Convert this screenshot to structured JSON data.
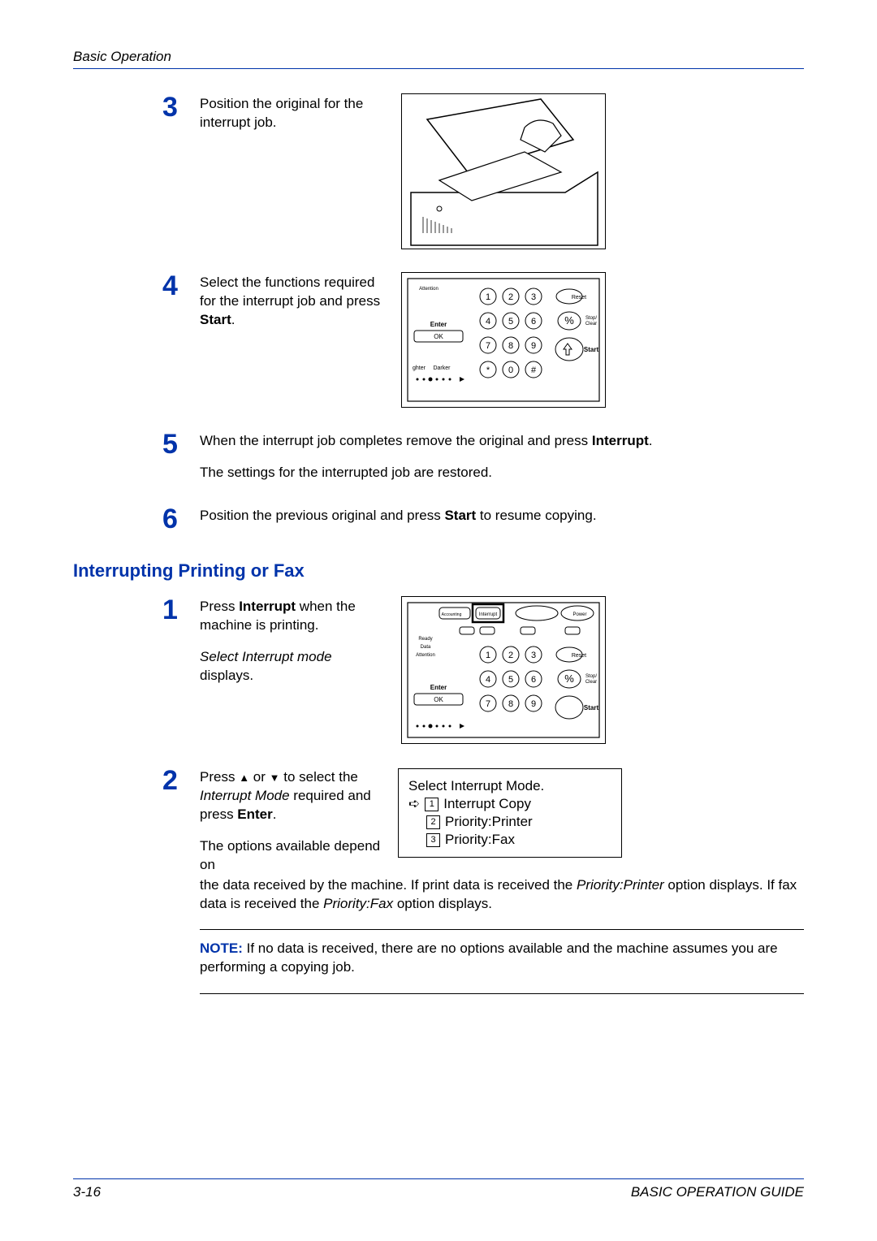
{
  "header": {
    "section": "Basic Operation"
  },
  "steps_a": {
    "s3": {
      "num": "3",
      "text": "Position the original for the interrupt job."
    },
    "s4": {
      "num": "4",
      "text_a": "Select the functions required for the interrupt job and press ",
      "bold": "Start",
      "text_b": "."
    },
    "s5": {
      "num": "5",
      "line1_a": "When the interrupt job completes remove the original and press ",
      "line1_bold": "Interrupt",
      "line1_b": ".",
      "line2": "The settings for the interrupted job are restored."
    },
    "s6": {
      "num": "6",
      "text_a": "Position the previous original and press ",
      "bold": "Start",
      "text_b": " to resume copying."
    }
  },
  "section_title": "Interrupting Printing or Fax",
  "steps_b": {
    "s1": {
      "num": "1",
      "line1_a": "Press ",
      "line1_bold": "Interrupt",
      "line1_b": " when the machine is printing.",
      "line2_i": "Select Interrupt mode",
      "line2_b": " displays."
    },
    "s2": {
      "num": "2",
      "line1_a": "Press ",
      "tri_up": "▲",
      "line1_mid": " or ",
      "tri_down": "▼",
      "line1_b": " to select the ",
      "line1_i": "Interrupt Mode",
      "line1_c": " required and press ",
      "line1_bold": "Enter",
      "line1_d": ".",
      "para_a": "The options available depend on the data received by the machine. If print data is received the ",
      "para_i1": "Priority:Printer",
      "para_b": " option displays. If fax data is received the ",
      "para_i2": "Priority:Fax",
      "para_c": " option displays."
    }
  },
  "lcd": {
    "title": "Select Interrupt Mode.",
    "opt1": "Interrupt Copy",
    "opt2": "Priority:Printer",
    "opt3": "Priority:Fax",
    "arrow": "➪",
    "n1": "1",
    "n2": "2",
    "n3": "3"
  },
  "note": {
    "label": "NOTE:",
    "text": " If no data is received, there are no options available and the machine assumes you are performing a copying job."
  },
  "keypad": {
    "nums": [
      "1",
      "2",
      "3",
      "4",
      "5",
      "6",
      "7",
      "8",
      "9",
      "*",
      "0",
      "#"
    ],
    "pct": "%",
    "enter": "Enter",
    "reset": "Reset",
    "stop": "Stop/\nClear",
    "start": "Start",
    "lighter": "ghter",
    "darker": "Darker",
    "attention": "Attention",
    "ready": "Ready",
    "data": "Data",
    "acct": "Accounting",
    "interrupt": "Interrupt",
    "power": "Power"
  },
  "footer": {
    "page": "3-16",
    "doc": "BASIC OPERATION GUIDE"
  }
}
